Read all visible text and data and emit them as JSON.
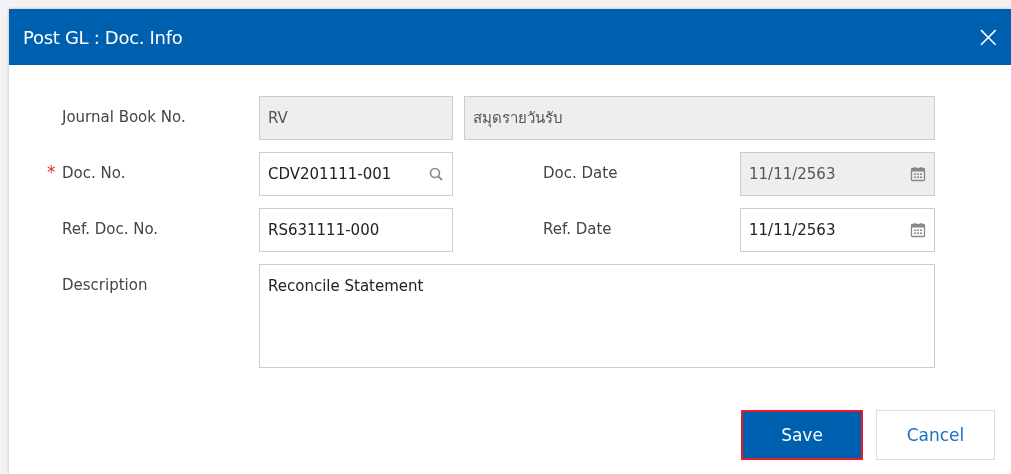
{
  "window": {
    "title": "Post GL : Doc. Info",
    "close_icon": "×"
  },
  "form": {
    "rows": [
      {
        "label": "Journal Book No.",
        "fields": [
          {
            "kind": "text",
            "value": "RV",
            "disabled": true
          },
          {
            "kind": "wide",
            "value": "สมุดรายวันรับ",
            "disabled": true
          }
        ]
      },
      {
        "label": "Doc. No.",
        "required_mark": "*",
        "fields": [
          {
            "kind": "search",
            "value": "CDV201111-001",
            "disabled": false
          }
        ],
        "label_2": "Doc. Date",
        "fields_2": [
          {
            "kind": "date",
            "value": "11/11/2563",
            "disabled": true
          }
        ]
      },
      {
        "label": "Ref. Doc. No.",
        "fields": [
          {
            "kind": "text",
            "value": "RS631111-000",
            "disabled": false
          }
        ],
        "label_2": "Ref. Date",
        "fields_2": [
          {
            "kind": "date",
            "value": "11/11/2563",
            "disabled": false
          }
        ]
      },
      {
        "label": "Description",
        "fields": [
          {
            "kind": "textarea",
            "value": "Reconcile Statement",
            "disabled": false
          }
        ]
      }
    ]
  },
  "buttons": [
    {
      "label": "Save",
      "kind": "primary",
      "highlighted": true
    },
    {
      "label": "Cancel",
      "kind": "secondary",
      "highlighted": false
    }
  ]
}
